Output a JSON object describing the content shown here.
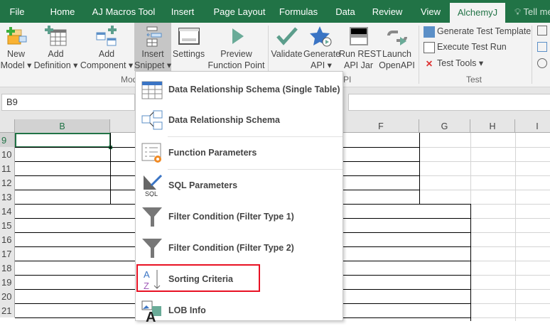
{
  "tabs": [
    "File",
    "Home",
    "AJ Macros Tool",
    "Insert",
    "Page Layout",
    "Formulas",
    "Data",
    "Review",
    "View",
    "AlchemyJ",
    "Tell me"
  ],
  "ribbon": {
    "new_model": [
      "New",
      "Model ▾"
    ],
    "add_definition": [
      "Add",
      "Definition ▾"
    ],
    "add_component": [
      "Add",
      "Component ▾"
    ],
    "insert_snippet": [
      "Insert",
      "Snippet ▾"
    ],
    "settings": [
      "Settings",
      ""
    ],
    "preview": [
      "Preview",
      "Function Point"
    ],
    "validate": [
      "Validate",
      ""
    ],
    "generate_api": [
      "Generate",
      "API ▾"
    ],
    "run_rest": [
      "Run REST",
      "API Jar"
    ],
    "launch_openapi": [
      "Launch",
      "OpenAPI"
    ],
    "generate_test_template": "Generate Test Template",
    "execute_test_run": "Execute Test Run",
    "test_tools": "Test Tools ▾",
    "group_model": "Mod",
    "group_api": "PI",
    "group_test": "Test"
  },
  "name_box": "B9",
  "columns": [
    "B",
    "F",
    "G",
    "H",
    "I"
  ],
  "rows": [
    "9",
    "10",
    "11",
    "12",
    "13",
    "14",
    "15",
    "16",
    "17",
    "18",
    "19",
    "20",
    "21"
  ],
  "menu": {
    "items": [
      "Data Relationship Schema (Single Table)",
      "Data Relationship Schema",
      "Function Parameters",
      "SQL Parameters",
      "Filter Condition (Filter Type 1)",
      "Filter Condition (Filter Type 2)",
      "Sorting Criteria",
      "LOB Info"
    ],
    "highlighted": "Sorting Criteria"
  },
  "colors": {
    "excel_green": "#217346",
    "highlight_red": "#e81123"
  }
}
